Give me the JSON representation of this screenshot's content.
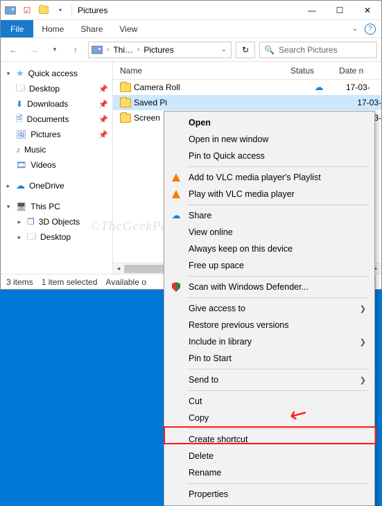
{
  "title": "Pictures",
  "ribbon": {
    "file": "File",
    "home": "Home",
    "share": "Share",
    "view": "View"
  },
  "breadcrumb": {
    "root": "Thi…",
    "current": "Pictures"
  },
  "search": {
    "placeholder": "Search Pictures"
  },
  "navpane": {
    "quick_access": "Quick access",
    "desktop": "Desktop",
    "downloads": "Downloads",
    "documents": "Documents",
    "pictures": "Pictures",
    "music": "Music",
    "videos": "Videos",
    "onedrive": "OneDrive",
    "this_pc": "This PC",
    "objects3d": "3D Objects",
    "desktop2": "Desktop"
  },
  "columns": {
    "name": "Name",
    "status": "Status",
    "date": "Date n"
  },
  "rows": [
    {
      "name": "Camera Roll",
      "status": "cloud",
      "date": "17-03-"
    },
    {
      "name": "Saved Pi",
      "status": "check",
      "date": "17-03-"
    },
    {
      "name": "Screen",
      "status": "",
      "date": "17-03-"
    }
  ],
  "statusbar": {
    "count": "3 items",
    "selected": "1 item selected",
    "avail": "Available o"
  },
  "ctx": {
    "open": "Open",
    "open_new": "Open in new window",
    "pin_qa": "Pin to Quick access",
    "vlc_add": "Add to VLC media player's Playlist",
    "vlc_play": "Play with VLC media player",
    "share": "Share",
    "view_online": "View online",
    "always_keep": "Always keep on this device",
    "free_up": "Free up space",
    "defender": "Scan with Windows Defender...",
    "give_access": "Give access to",
    "restore": "Restore previous versions",
    "include_lib": "Include in library",
    "pin_start": "Pin to Start",
    "send_to": "Send to",
    "cut": "Cut",
    "copy": "Copy",
    "shortcut": "Create shortcut",
    "delete": "Delete",
    "rename": "Rename",
    "properties": "Properties"
  },
  "watermark": "©TheGeekPage.com"
}
